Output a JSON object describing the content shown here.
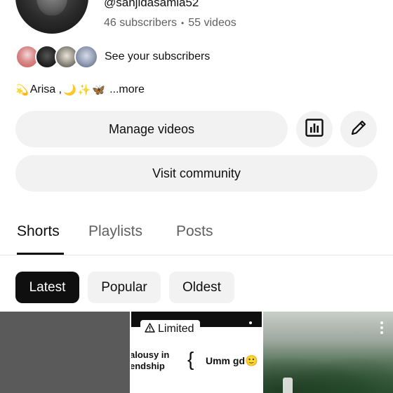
{
  "channel": {
    "handle": "@sanjidasamia52",
    "subscribers": "46 subscribers",
    "videos": "55 videos",
    "separator": "•",
    "see_subscribers": "See your subscribers",
    "bio_text": "Arisa ,",
    "bio_more": "...more"
  },
  "actions": {
    "manage_videos": "Manage videos",
    "visit_community": "Visit community",
    "analytics_icon": "bar-chart-icon",
    "edit_icon": "pencil-icon"
  },
  "tabs": [
    {
      "label": "Shorts",
      "active": true
    },
    {
      "label": "Playlists",
      "active": false
    },
    {
      "label": "Posts",
      "active": false
    }
  ],
  "filters": [
    {
      "label": "Latest",
      "selected": true
    },
    {
      "label": "Popular",
      "selected": false
    },
    {
      "label": "Oldest",
      "selected": false
    }
  ],
  "thumbnails": [
    {
      "badge": ""
    },
    {
      "badge": "Limited",
      "badge_icon": "warning-icon",
      "text_left_1": "alousy in",
      "text_left_2": "endship",
      "text_right": "Umm gd"
    },
    {
      "badge": ""
    }
  ],
  "colors": {
    "primary_text": "#0f0f0f",
    "secondary_text": "#606060",
    "pill_bg": "#f2f2f2",
    "active_chip_bg": "#0f0f0f"
  }
}
